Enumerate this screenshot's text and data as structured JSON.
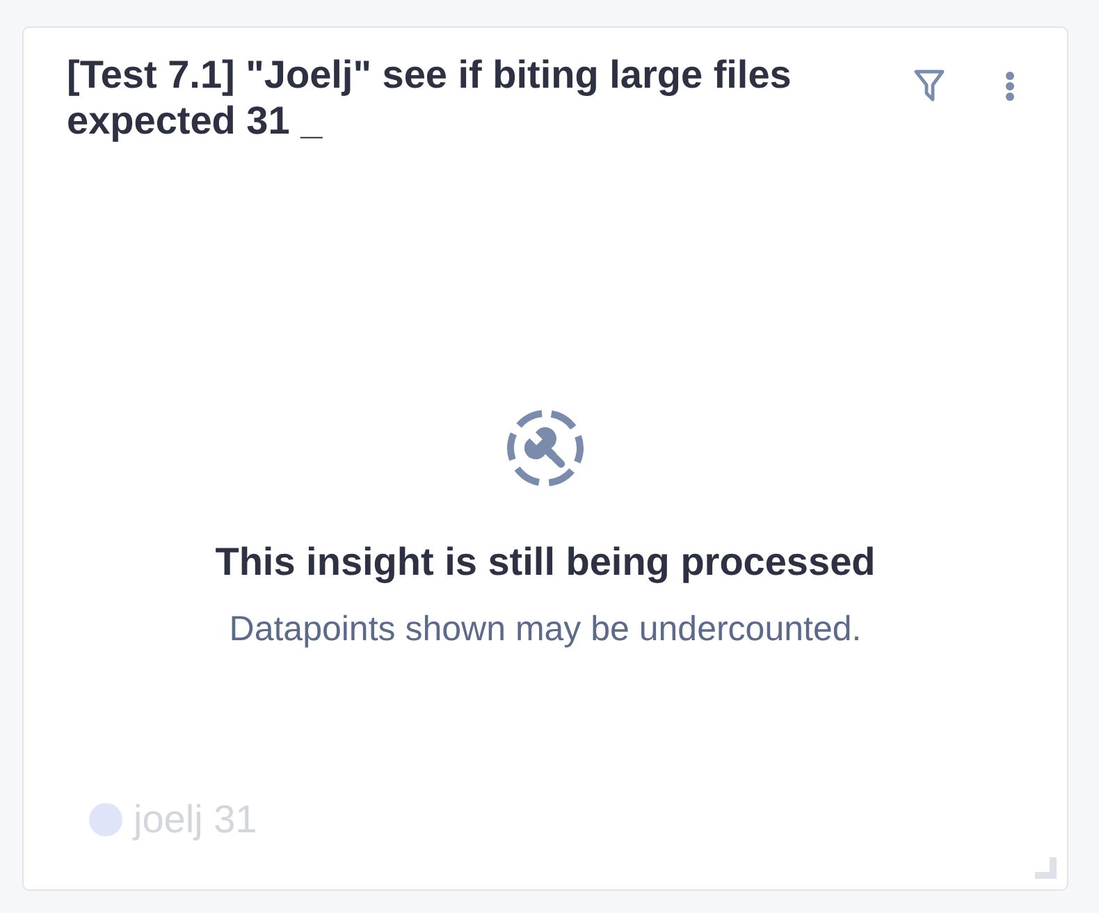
{
  "card": {
    "title": "[Test 7.1] \"Joelj\" see if biting large files expected 31 _"
  },
  "status": {
    "heading": "This insight is still being processed",
    "message": "Datapoints shown may be undercounted."
  },
  "legend": [
    {
      "label": "joelj 31",
      "color": "#dfe4f9"
    }
  ]
}
